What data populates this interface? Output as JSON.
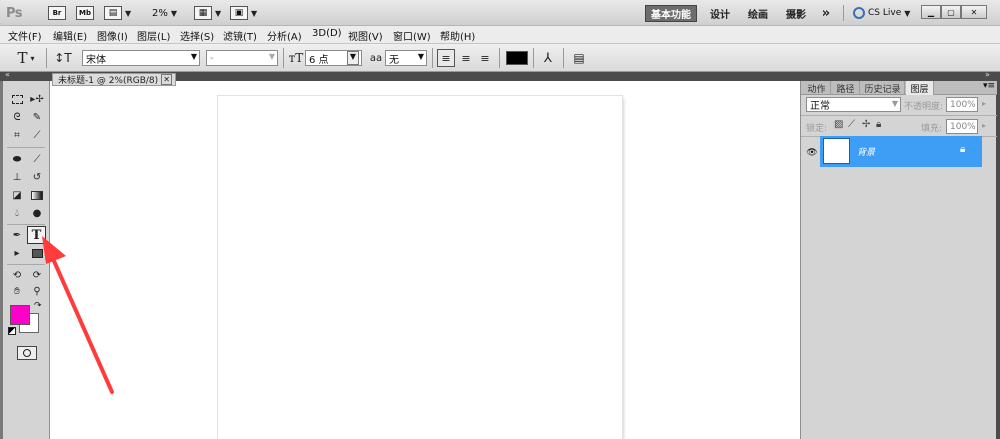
{
  "app": {
    "logo": "Ps",
    "bridge_label": "Br",
    "minibridge_label": "Mb",
    "zoom": "2%",
    "workspaces": [
      "基本功能",
      "设计",
      "绘画",
      "摄影"
    ],
    "more": "»",
    "cs_live": "CS Live"
  },
  "menu": [
    "文件(F)",
    "编辑(E)",
    "图像(I)",
    "图层(L)",
    "选择(S)",
    "滤镜(T)",
    "分析(A)",
    "3D(D)",
    "视图(V)",
    "窗口(W)",
    "帮助(H)"
  ],
  "options": {
    "font_family": "宋体",
    "font_style": "-",
    "font_size": "6 点",
    "aa_label": "aa",
    "aa_value": "无",
    "text_color": "#000000"
  },
  "document": {
    "tab_title": "未标题-1 @ 2%(RGB/8)"
  },
  "toolbox": {
    "foreground": "#ff00c8",
    "background": "#ffffff"
  },
  "panels": {
    "tabs": [
      "动作",
      "路径",
      "历史记录",
      "图层"
    ],
    "blend_mode": "正常",
    "opacity_label": "不透明度:",
    "opacity_value": "100%",
    "lock_label": "锁定:",
    "fill_label": "填充:",
    "fill_value": "100%",
    "layer_name": "背景"
  }
}
